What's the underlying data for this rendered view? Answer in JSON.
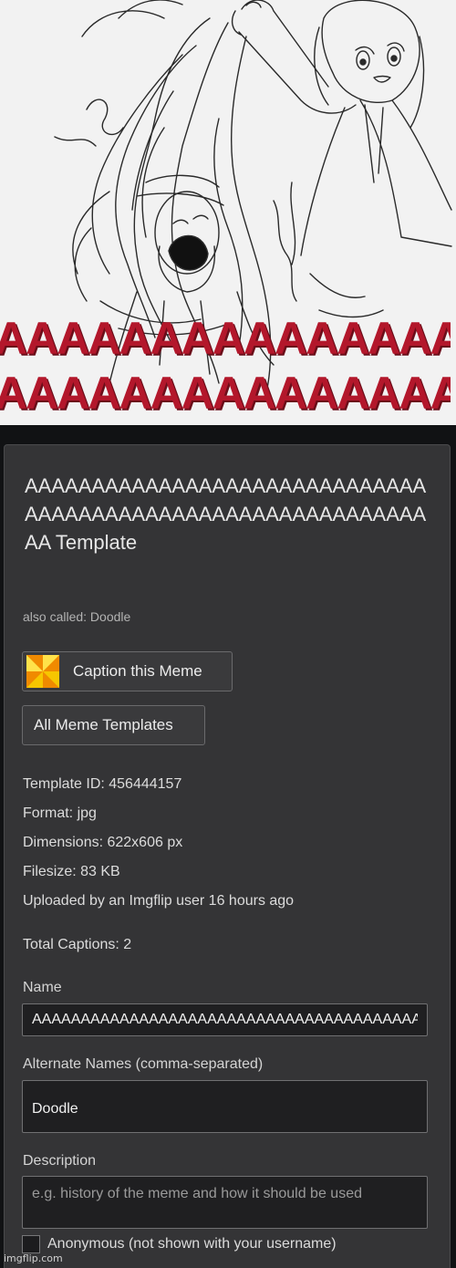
{
  "meme_image": {
    "scream_text_line1": "AAAAAAAAAAAAAAAAAAA",
    "scream_text_line2": "AAAAAAAAAAAAAAAAAAA",
    "text_color": "#b3172b"
  },
  "template": {
    "title": "AAAAAAAAAAAAAAAAAAAAAAAAAAAAAAAAAAAAAAAAAAAAAAAAAAAAAAAAAAAAAA Template",
    "also_called": "also called: Doodle"
  },
  "buttons": {
    "caption": "Caption this Meme",
    "all_templates": "All Meme Templates",
    "caption_icon": "pinwheel-icon"
  },
  "details": {
    "template_id": "Template ID: 456444157",
    "format": "Format: jpg",
    "dimensions": "Dimensions: 622x606 px",
    "filesize": "Filesize: 83 KB",
    "uploaded": "Uploaded by an Imgflip user 16 hours ago",
    "total_captions": "Total Captions: 2"
  },
  "form": {
    "name_label": "Name",
    "name_value": "AAAAAAAAAAAAAAAAAAAAAAAAAAAAAAAAAAAAAAAAAAAAAAAAAA",
    "alt_label": "Alternate Names (comma-separated)",
    "alt_value": "Doodle",
    "desc_label": "Description",
    "desc_placeholder": "e.g. history of the meme and how it should be used",
    "anonymous_label": "Anonymous (not shown with your username)"
  },
  "watermark": "imgflip.com",
  "colors": {
    "panel": "#343436",
    "background": "#111214"
  }
}
